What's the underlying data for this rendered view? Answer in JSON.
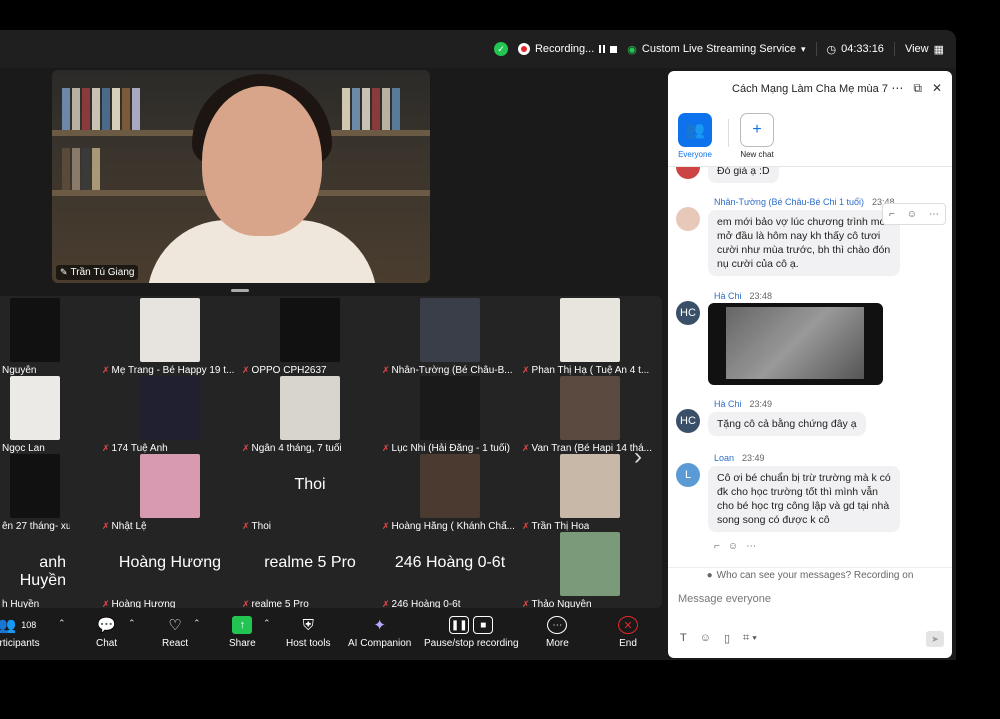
{
  "topbar": {
    "recording_label": "Recording...",
    "streaming_label": "Custom Live Streaming Service",
    "timer": "04:33:16",
    "view_label": "View"
  },
  "speaker": {
    "name": "Trần Tú Giang"
  },
  "grid": {
    "tiles": [
      {
        "label": "Nguyễn",
        "big": ""
      },
      {
        "label": "Mẹ Trang - Bé Happy 19 t...",
        "big": ""
      },
      {
        "label": "OPPO CPH2637",
        "big": ""
      },
      {
        "label": "Nhân-Tường (Bé Châu-B...",
        "big": ""
      },
      {
        "label": "Phan Thị Hạ ( Tuệ An 4 t...",
        "big": ""
      },
      {
        "label": "Ngọc Lan",
        "big": ""
      },
      {
        "label": "174 Tuệ Anh",
        "big": ""
      },
      {
        "label": "Ngân 4 tháng, 7 tuổi",
        "big": ""
      },
      {
        "label": "Lục Nhi (Hải Đăng - 1 tuổi)",
        "big": ""
      },
      {
        "label": "Van Tran (Bé Hapi 14 thá...",
        "big": ""
      },
      {
        "label": "ên 27 tháng- xuân...",
        "big": ""
      },
      {
        "label": "Nhật Lệ",
        "big": ""
      },
      {
        "label": "Thoi",
        "big": "Thoi"
      },
      {
        "label": "Hoàng Hằng ( Khánh Chấ...",
        "big": ""
      },
      {
        "label": "Trần Thị Hoa",
        "big": ""
      },
      {
        "label": "h Huyền",
        "big": "anh Huyền"
      },
      {
        "label": "Hoàng Hương",
        "big": "Hoàng Hương"
      },
      {
        "label": "realme 5 Pro",
        "big": "realme 5 Pro"
      },
      {
        "label": "246 Hoàng 0-6t",
        "big": "246 Hoàng 0-6t"
      },
      {
        "label": "Thảo Nguyễn",
        "big": ""
      }
    ]
  },
  "toolbar": {
    "participants_label": "articipants",
    "participants_count": "108",
    "chat_label": "Chat",
    "react_label": "React",
    "share_label": "Share",
    "host_tools_label": "Host tools",
    "ai_companion_label": "AI Companion",
    "pause_stop_label": "Pause/stop recording",
    "more_label": "More",
    "end_label": "End"
  },
  "chat": {
    "title": "Cách Mạng Làm Cha Mẹ mùa 7",
    "everyone_label": "Everyone",
    "new_chat_label": "New chat",
    "messages": [
      {
        "sender": "",
        "time": "",
        "text": "Đó giá ạ :D"
      },
      {
        "sender": "Nhân-Tường (Bé Châu-Bé Chi 1 tuổi)",
        "time": "23:48",
        "text": "em mới bảo vợ lúc chương trình mới mở đầu là hôm nay kh thấy cô tươi cười như mùa trước, bh thì chào đón nụ cười của cô ạ."
      },
      {
        "sender": "Hà Chi",
        "time": "23:48",
        "text": "",
        "initials": "HC"
      },
      {
        "sender": "Hà Chi",
        "time": "23:49",
        "text": "Tặng cô cả bằng chứng đây ạ",
        "initials": "HC"
      },
      {
        "sender": "Loan",
        "time": "23:49",
        "text": "Cô ơi bé chuẩn bị trừ trường mà k có đk cho học trường tốt thì mình vẫn cho bé học trg công lập và gd tại nhà song song có được k cô",
        "initials": "L"
      }
    ],
    "visibility_note": "Who can see your messages? Recording on",
    "composer_placeholder": "Message everyone"
  },
  "colors": {
    "accent": "#0e72ed",
    "recording_red": "#e02828",
    "secure_green": "#23c552"
  }
}
